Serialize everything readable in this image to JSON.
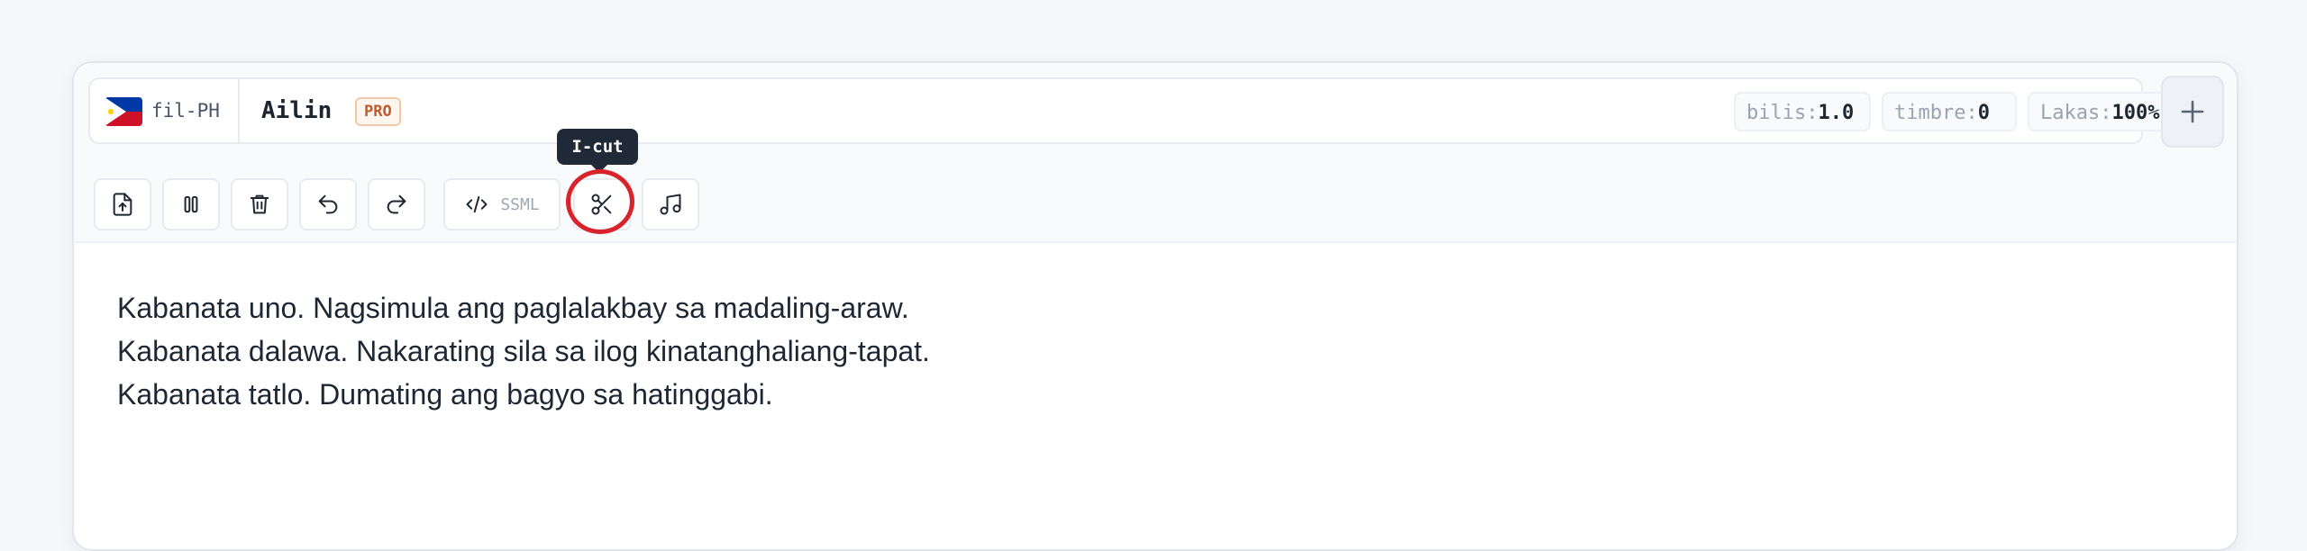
{
  "voice": {
    "lang_code": "fil-PH",
    "name": "Ailin",
    "tier": "PRO"
  },
  "params": [
    {
      "key": "bilis:",
      "value": "1.0"
    },
    {
      "key": "timbre:",
      "value": "0"
    },
    {
      "key": "Lakas:",
      "value": "100%"
    }
  ],
  "toolbar": {
    "ssml_label": "SSML",
    "tooltip": "I-cut"
  },
  "editor": {
    "lines": [
      "Kabanata uno. Nagsimula ang paglalakbay sa madaling-araw.",
      "Kabanata dalawa. Nakarating sila sa ilog kinatanghaliang-tapat.",
      "Kabanata tatlo. Dumating ang bagyo sa hatinggabi."
    ]
  },
  "colors": {
    "accent_ring": "#d8232a",
    "pro_badge": "#c0582a"
  }
}
